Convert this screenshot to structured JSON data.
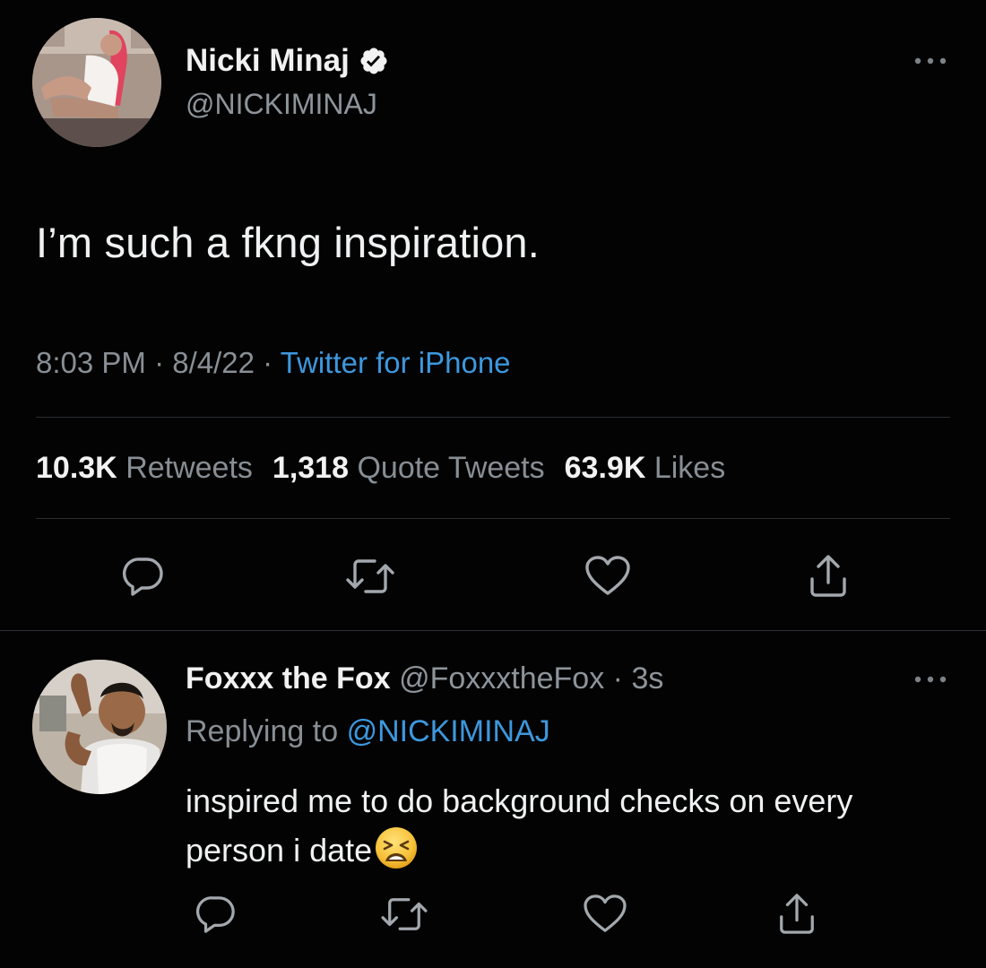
{
  "tweet": {
    "author_name": "Nicki Minaj",
    "author_handle": "@NICKIMINAJ",
    "verified_icon": "verified-badge-icon",
    "text": "I’m such a fkng inspiration.",
    "time": "8:03 PM",
    "date": "8/4/22",
    "separator": "·",
    "source": "Twitter for iPhone",
    "stats": {
      "retweets_count": "10.3K",
      "retweets_label": "Retweets",
      "quotes_count": "1,318",
      "quotes_label": "Quote Tweets",
      "likes_count": "63.9K",
      "likes_label": "Likes"
    },
    "actions": [
      "reply-icon",
      "retweet-icon",
      "like-icon",
      "share-icon"
    ]
  },
  "reply": {
    "author_name": "Foxxx the Fox",
    "author_handle": "@FoxxxtheFox",
    "separator": "·",
    "age": "3s",
    "replying_label": "Replying to",
    "replying_to": "@NICKIMINAJ",
    "text": "inspired me to do background checks on every person i date",
    "emoji": "weary-face-emoji",
    "actions": [
      "reply-icon",
      "retweet-icon",
      "like-icon",
      "share-icon"
    ]
  },
  "colors": {
    "background": "#030303",
    "link_blue": "#3d98de",
    "verified_blue": "#1d9bf0",
    "muted_text": "#888f95",
    "divider": "#2b2f33"
  }
}
